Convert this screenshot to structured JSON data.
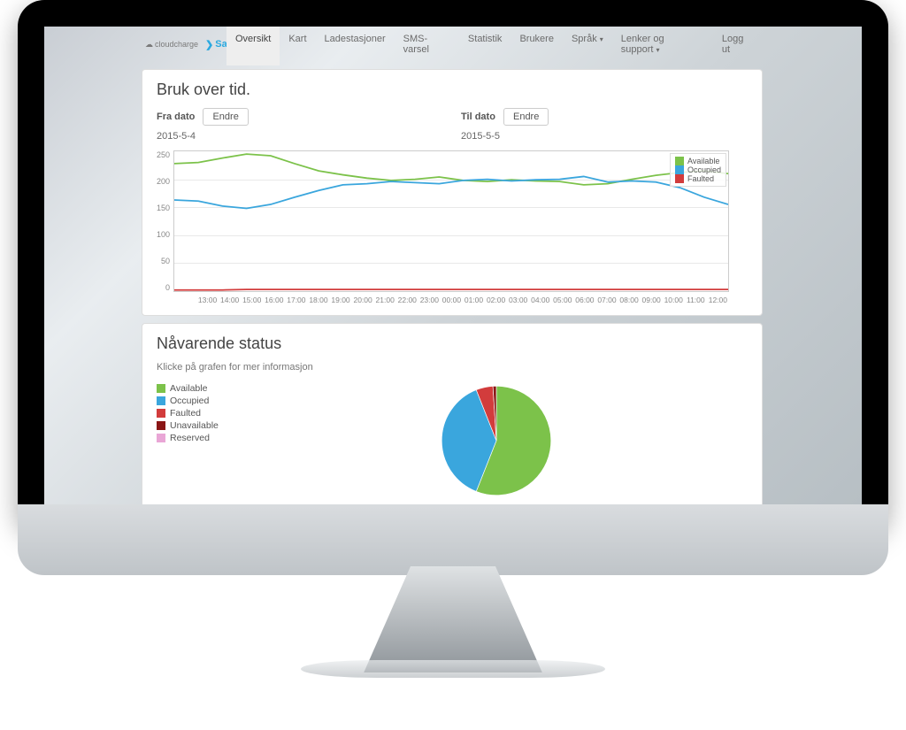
{
  "nav": {
    "logo1": "cloudcharge",
    "logo2": "Salto",
    "items": [
      "Oversikt",
      "Kart",
      "Ladestasjoner",
      "SMS-varsel",
      "Statistik",
      "Brukere"
    ],
    "right": [
      "Språk",
      "Lenker og support",
      "Logg ut"
    ]
  },
  "panel1": {
    "title": "Bruk over tid.",
    "from_label": "Fra dato",
    "to_label": "Til dato",
    "change": "Endre",
    "from_date": "2015-5-4",
    "to_date": "2015-5-5"
  },
  "panel2": {
    "title": "Nåvarende status",
    "subtitle": "Klicke på grafen for mer informasjon",
    "legend": [
      "Available",
      "Occupied",
      "Faulted",
      "Unavailable",
      "Reserved"
    ]
  },
  "chart_data": [
    {
      "type": "line",
      "title": "Bruk over tid.",
      "xlabel": "",
      "ylabel": "",
      "ylim": [
        0,
        250
      ],
      "y_ticks": [
        0,
        50,
        100,
        150,
        200,
        250
      ],
      "x": [
        "13:00",
        "14:00",
        "15:00",
        "16:00",
        "17:00",
        "18:00",
        "19:00",
        "20:00",
        "21:00",
        "22:00",
        "23:00",
        "00:00",
        "01:00",
        "02:00",
        "03:00",
        "04:00",
        "05:00",
        "06:00",
        "07:00",
        "08:00",
        "09:00",
        "10:00",
        "11:00",
        "12:00"
      ],
      "series": [
        {
          "name": "Available",
          "color": "#7cc24a",
          "values": [
            228,
            230,
            238,
            245,
            242,
            228,
            215,
            208,
            202,
            198,
            200,
            204,
            198,
            196,
            199,
            197,
            196,
            190,
            192,
            200,
            207,
            212,
            215,
            210
          ]
        },
        {
          "name": "Occupied",
          "color": "#3aa6dd",
          "values": [
            163,
            161,
            152,
            148,
            155,
            168,
            180,
            190,
            192,
            196,
            194,
            192,
            198,
            200,
            197,
            199,
            200,
            205,
            195,
            197,
            195,
            185,
            168,
            155
          ]
        },
        {
          "name": "Faulted",
          "color": "#d23c3c",
          "values": [
            2,
            2,
            2,
            3,
            3,
            3,
            3,
            3,
            3,
            3,
            3,
            3,
            3,
            3,
            3,
            3,
            3,
            3,
            3,
            3,
            3,
            3,
            3,
            3
          ]
        }
      ]
    },
    {
      "type": "pie",
      "title": "Nåvarende status",
      "series": [
        {
          "name": "Available",
          "value": 56,
          "color": "#7cc24a"
        },
        {
          "name": "Occupied",
          "value": 38,
          "color": "#3aa6dd"
        },
        {
          "name": "Faulted",
          "value": 5,
          "color": "#d23c3c"
        },
        {
          "name": "Unavailable",
          "value": 1,
          "color": "#8a1616"
        },
        {
          "name": "Reserved",
          "value": 0,
          "color": "#e9a6d6"
        }
      ]
    }
  ]
}
